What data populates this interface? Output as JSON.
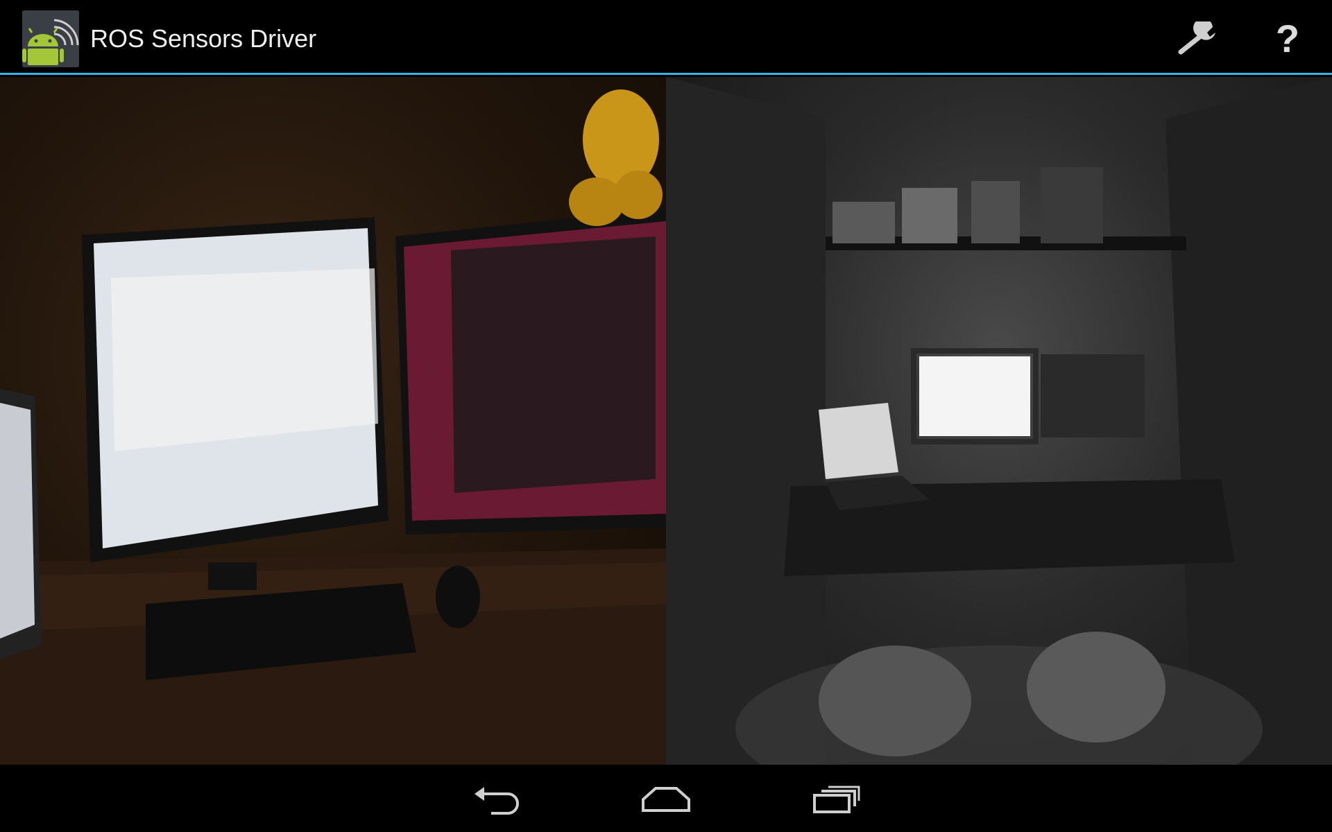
{
  "action_bar": {
    "title": "ROS Sensors Driver",
    "app_icon": "android-robot-wifi-icon",
    "actions": [
      {
        "id": "settings",
        "icon": "wrench-icon"
      },
      {
        "id": "help",
        "icon": "help-icon",
        "label": "?"
      }
    ],
    "divider_color": "#33b5e5"
  },
  "camera_views": [
    {
      "id": "rgb-camera",
      "description": ""
    },
    {
      "id": "grayscale-camera",
      "description": ""
    }
  ],
  "nav_bar": {
    "buttons": [
      {
        "id": "back",
        "icon": "back-arrow-icon"
      },
      {
        "id": "home",
        "icon": "home-icon"
      },
      {
        "id": "recents",
        "icon": "recent-apps-icon"
      }
    ]
  },
  "colors": {
    "accent": "#33b5e5",
    "android_green": "#a4c639"
  }
}
